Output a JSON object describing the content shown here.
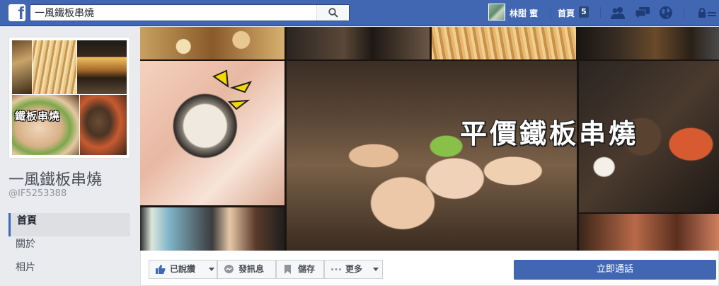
{
  "topbar": {
    "logo": "f",
    "search_value": "一風鐵板串燒",
    "user_name": "林甜 蜜",
    "home_label": "首頁",
    "home_count": "5",
    "brand_color": "#4267b2"
  },
  "icons": [
    "facebook-logo-icon",
    "search-icon",
    "friend-requests-icon",
    "messages-icon",
    "notifications-globe-icon",
    "privacy-lock-icon"
  ],
  "profile": {
    "picture_text": "鐵板串燒",
    "page_name": "一風鐵板串燒",
    "handle": "@IF5253388"
  },
  "nav": {
    "items": [
      "首頁",
      "關於",
      "相片"
    ],
    "active": "首頁"
  },
  "cover": {
    "title": "平價鐵板串燒"
  },
  "actions": {
    "like": "已說讚",
    "message": "發訊息",
    "save": "儲存",
    "more": "更多",
    "call": "立即通話"
  }
}
